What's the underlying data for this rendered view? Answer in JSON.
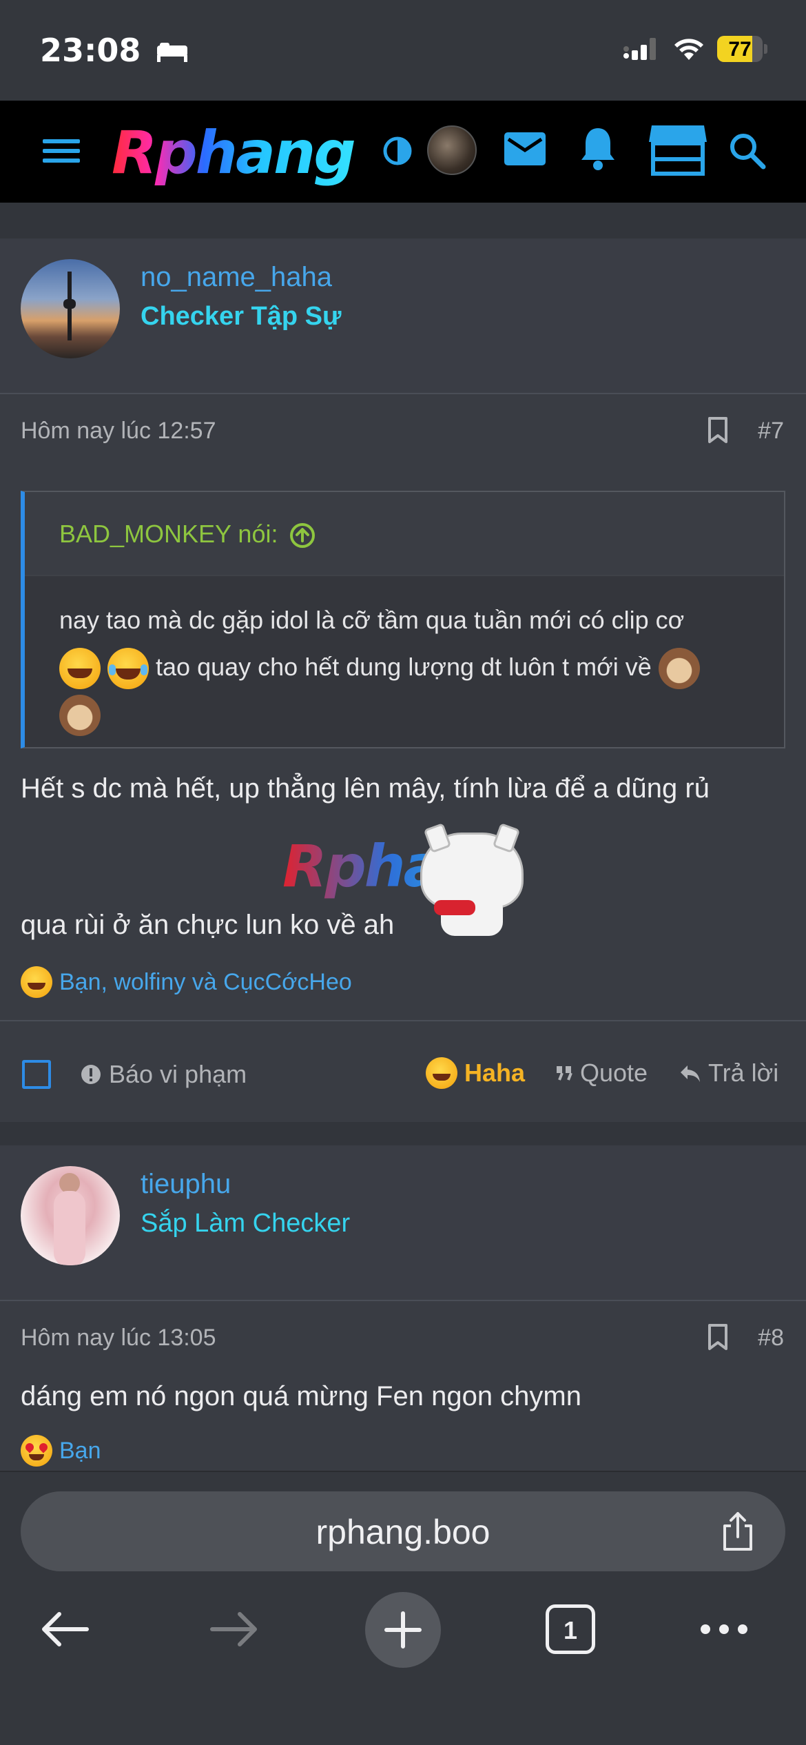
{
  "status": {
    "time": "23:08",
    "battery": "77",
    "battery_level": 0.77
  },
  "nav": {
    "logo": "Rphang",
    "icons": [
      "menu-icon",
      "contrast-icon",
      "avatar",
      "mail-icon",
      "bell-icon",
      "store-icon",
      "search-icon"
    ]
  },
  "posts": [
    {
      "username": "no_name_haha",
      "usertitle": "Checker Tập Sự",
      "time": "Hôm nay lúc 12:57",
      "number": "#7",
      "quote": {
        "author": "BAD_MONKEY nói:",
        "line1": "nay tao mà dc gặp idol là cỡ tầm qua tuần mới có clip cơ",
        "line2": "tao quay cho hết dung lượng dt luôn t mới về"
      },
      "text_line1": "Hết s dc mà hết, up thẳng lên mây, tính lừa để a dũng rủ",
      "text_line2": "qua rùi ở ăn chực lun ko về ah",
      "sticker_text": "Rphang",
      "reactions": "Bạn, wolfiny và CụcCớcHeo",
      "actions": {
        "report": "Báo vi phạm",
        "reaction": "Haha",
        "quote": "Quote",
        "reply": "Trả lời"
      }
    },
    {
      "username": "tieuphu",
      "usertitle": "Sắp Làm Checker",
      "time": "Hôm nay lúc 13:05",
      "number": "#8",
      "text_line1": "dáng em nó ngon quá mừng Fen ngon chymn",
      "reactions": "Bạn"
    }
  ],
  "browser": {
    "url": "rphang.boo",
    "tab_count": "1"
  },
  "colors": {
    "accent": "#47a7eb",
    "title": "#35d4ee",
    "quote_author": "#8ec63f",
    "reaction": "#f5b324"
  }
}
